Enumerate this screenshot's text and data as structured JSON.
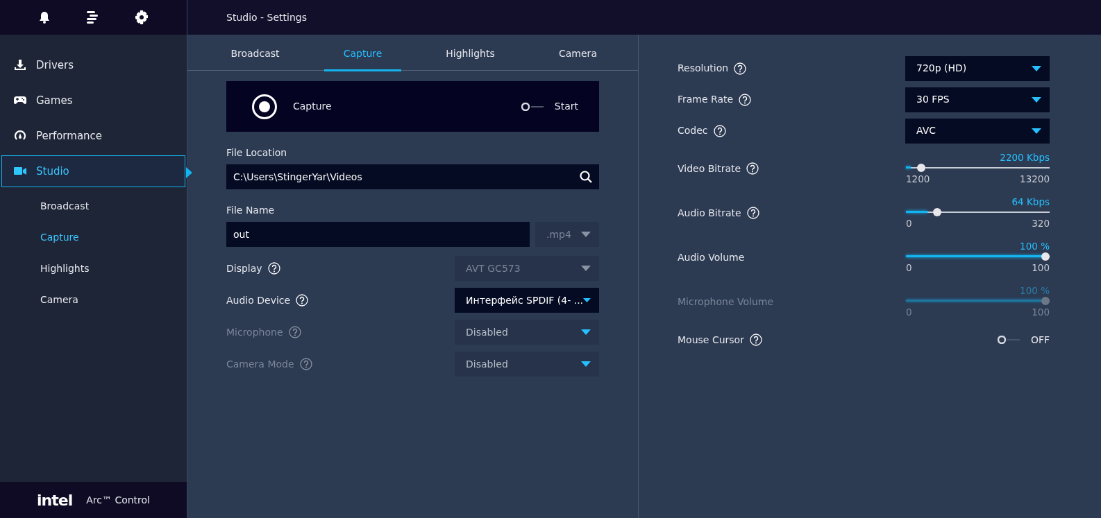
{
  "header": {
    "title": "Studio - Settings"
  },
  "sidebar": {
    "nav": [
      {
        "label": "Drivers",
        "kind": "download",
        "selected": false
      },
      {
        "label": "Games",
        "kind": "gamepad",
        "selected": false
      },
      {
        "label": "Performance",
        "kind": "gauge",
        "selected": false
      },
      {
        "label": "Studio",
        "kind": "camera",
        "selected": true,
        "children": [
          {
            "label": "Broadcast",
            "selected": false
          },
          {
            "label": "Capture",
            "selected": true
          },
          {
            "label": "Highlights",
            "selected": false
          },
          {
            "label": "Camera",
            "selected": false
          }
        ]
      }
    ],
    "brand": {
      "logo": "intel",
      "product": "Arc™ Control"
    }
  },
  "tabs": [
    {
      "label": "Broadcast",
      "selected": false
    },
    {
      "label": "Capture",
      "selected": true
    },
    {
      "label": "Highlights",
      "selected": false
    },
    {
      "label": "Camera",
      "selected": false
    }
  ],
  "capture_card": {
    "label": "Capture",
    "toggle": {
      "label": "Start",
      "on": false
    }
  },
  "file_location": {
    "label": "File Location",
    "value": "C:\\Users\\StingerYar\\Videos"
  },
  "file_name": {
    "label": "File Name",
    "value": "out",
    "extension": {
      "value": ".mp4",
      "disabled": true
    }
  },
  "left_settings": [
    {
      "label": "Display",
      "help": true,
      "value": "AVT GC573",
      "disabled": false,
      "field_disabled": true
    },
    {
      "label": "Audio Device",
      "help": true,
      "value": "Интерфейс SPDIF (4- ...",
      "disabled": false,
      "field_disabled": false
    },
    {
      "label": "Microphone",
      "help": true,
      "value": "Disabled",
      "disabled": true,
      "field_disabled": false
    },
    {
      "label": "Camera Mode",
      "help": true,
      "value": "Disabled",
      "disabled": true,
      "field_disabled": false
    }
  ],
  "right_settings": [
    {
      "kind": "dropdown",
      "label": "Resolution",
      "help": true,
      "value": "720p (HD)"
    },
    {
      "kind": "dropdown",
      "label": "Frame Rate",
      "help": true,
      "value": "30 FPS"
    },
    {
      "kind": "dropdown",
      "label": "Codec",
      "help": true,
      "value": "AVC"
    },
    {
      "kind": "slider",
      "label": "Video Bitrate",
      "help": true,
      "reading": "2200 Kbps",
      "level": 0.083,
      "min": "1200",
      "max": "13200",
      "disabled": false
    },
    {
      "kind": "slider",
      "label": "Audio Bitrate",
      "help": true,
      "reading": "64 Kbps",
      "level": 0.2,
      "min": "0",
      "max": "320",
      "disabled": false
    },
    {
      "kind": "slider",
      "label": "Audio Volume",
      "help": false,
      "reading": "100 %",
      "level": 1,
      "min": "0",
      "max": "100",
      "disabled": false
    },
    {
      "kind": "slider",
      "label": "Microphone Volume",
      "help": false,
      "reading": "100 %",
      "level": 1,
      "min": "0",
      "max": "100",
      "disabled": true
    },
    {
      "kind": "toggle",
      "label": "Mouse Cursor",
      "help": true,
      "toggle": {
        "label": "OFF",
        "on": false
      }
    }
  ]
}
